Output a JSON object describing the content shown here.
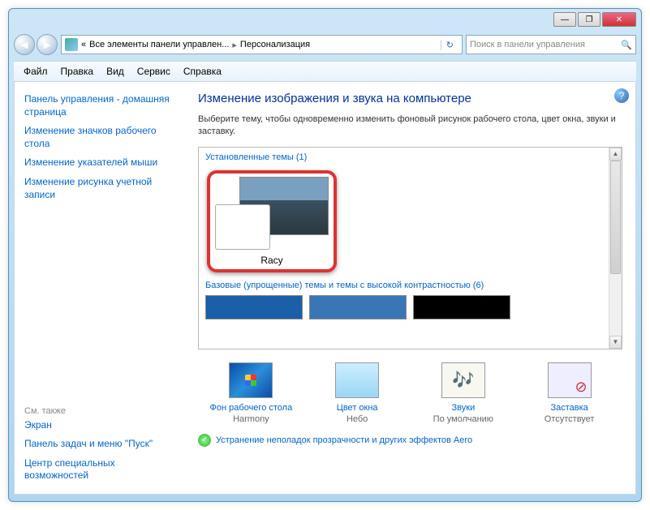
{
  "titlebar": {
    "min": "—",
    "max": "❐",
    "close": "✕"
  },
  "nav": {
    "back": "◄",
    "forward": "►"
  },
  "address": {
    "prefix": "«",
    "part1": "Все элементы панели управлен...",
    "part2": "Персонализация",
    "sep": "▸",
    "refresh": "↻"
  },
  "search": {
    "placeholder": "Поиск в панели управления",
    "icon": "🔍"
  },
  "menu": {
    "file": "Файл",
    "edit": "Правка",
    "view": "Вид",
    "service": "Сервис",
    "help": "Справка"
  },
  "sidebar": {
    "links": [
      "Панель управления - домашняя страница",
      "Изменение значков рабочего стола",
      "Изменение указателей мыши",
      "Изменение рисунка учетной записи"
    ],
    "see_also_label": "См. также",
    "see_also": [
      "Экран",
      "Панель задач и меню \"Пуск\"",
      "Центр специальных возможностей"
    ]
  },
  "main": {
    "help": "?",
    "heading": "Изменение изображения и звука на компьютере",
    "subheading": "Выберите тему, чтобы одновременно изменить фоновый рисунок рабочего стола, цвет окна, звуки и заставку.",
    "cat_installed": "Установленные темы (1)",
    "theme_name": "Racy",
    "cat_basic": "Базовые (упрощенные) темы и темы с высокой контрастностью (6)",
    "swatch_colors": [
      "#1a5fa8",
      "#3976b6",
      "#000000"
    ],
    "bottom": [
      {
        "key": "desktop",
        "title": "Фон рабочего стола",
        "sub": "Harmony"
      },
      {
        "key": "color",
        "title": "Цвет окна",
        "sub": "Небо"
      },
      {
        "key": "sounds",
        "title": "Звуки",
        "sub": "По умолчанию"
      },
      {
        "key": "saver",
        "title": "Заставка",
        "sub": "Отсутствует"
      }
    ],
    "troubleshoot": "Устранение неполадок прозрачности и других эффектов Aero"
  }
}
